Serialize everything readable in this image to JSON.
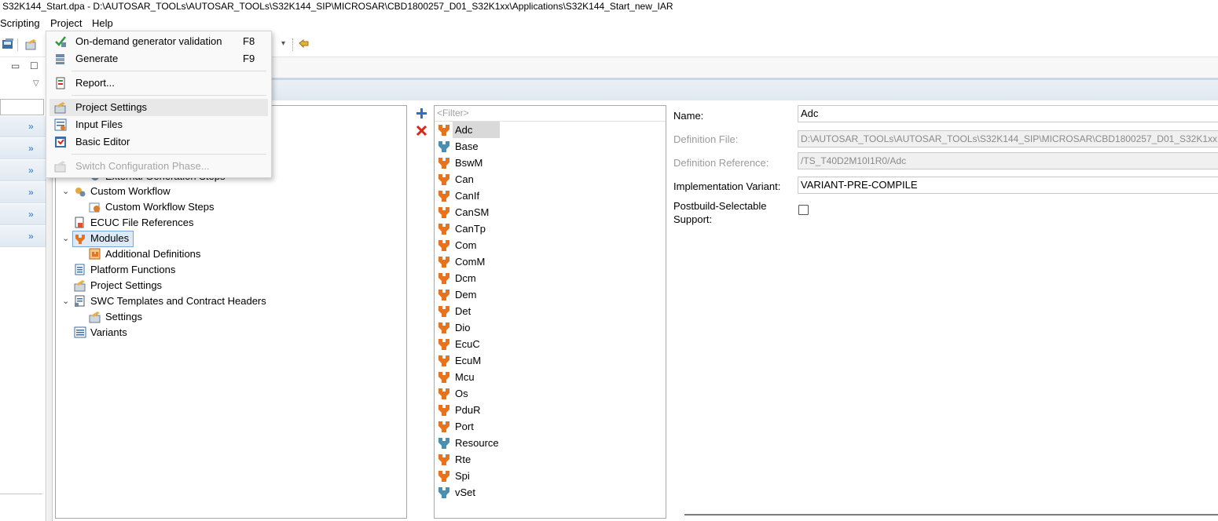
{
  "window": {
    "title": "S32K144_Start.dpa - D:\\AUTOSAR_TOOLs\\AUTOSAR_TOOLs\\S32K144_SIP\\MICROSAR\\CBD1800257_D01_S32K1xx\\Applications\\S32K144_Start_new_IAR"
  },
  "menubar": {
    "scripting": "Scripting",
    "project": "Project",
    "help": "Help"
  },
  "project_menu": {
    "items": [
      {
        "label": "On-demand generator validation",
        "shortcut": "F8"
      },
      {
        "label": "Generate",
        "shortcut": "F9"
      },
      {
        "label": "Report...",
        "shortcut": ""
      },
      {
        "label": "Project Settings",
        "shortcut": ""
      },
      {
        "label": "Input Files",
        "shortcut": ""
      },
      {
        "label": "Basic Editor",
        "shortcut": ""
      },
      {
        "label": "Switch Configuration Phase...",
        "shortcut": ""
      }
    ]
  },
  "tree": {
    "items": [
      {
        "label": "External Generation Steps"
      },
      {
        "label": "Custom Workflow"
      },
      {
        "label": "Custom Workflow Steps"
      },
      {
        "label": "ECUC File References"
      },
      {
        "label": "Modules"
      },
      {
        "label": "Additional Definitions"
      },
      {
        "label": "Platform Functions"
      },
      {
        "label": "Project Settings"
      },
      {
        "label": "SWC Templates and Contract Headers"
      },
      {
        "label": "Settings"
      },
      {
        "label": "Variants"
      }
    ]
  },
  "modules": {
    "filter_placeholder": "<Filter>",
    "items": [
      "Adc",
      "Base",
      "BswM",
      "Can",
      "CanIf",
      "CanSM",
      "CanTp",
      "Com",
      "ComM",
      "Dcm",
      "Dem",
      "Det",
      "Dio",
      "EcuC",
      "EcuM",
      "Mcu",
      "Os",
      "PduR",
      "Port",
      "Resource",
      "Rte",
      "Spi",
      "vSet"
    ],
    "selected": "Adc"
  },
  "properties": {
    "name_label": "Name:",
    "name_value": "Adc",
    "def_file_label": "Definition File:",
    "def_file_value": "D:\\AUTOSAR_TOOLs\\AUTOSAR_TOOLs\\S32K144_SIP\\MICROSAR\\CBD1800257_D01_S32K1xx",
    "def_ref_label": "Definition Reference:",
    "def_ref_value": "/TS_T40D2M10I1R0/Adc",
    "impl_variant_label": "Implementation Variant:",
    "impl_variant_value": "VARIANT-PRE-COMPILE",
    "postbuild_label_1": "Postbuild-Selectable",
    "postbuild_label_2": "Support:"
  },
  "colors": {
    "accent_blue": "#2a72c8",
    "module_orange": "#e8731e",
    "module_teal": "#4a8fb0",
    "delete_red": "#d9261c"
  }
}
